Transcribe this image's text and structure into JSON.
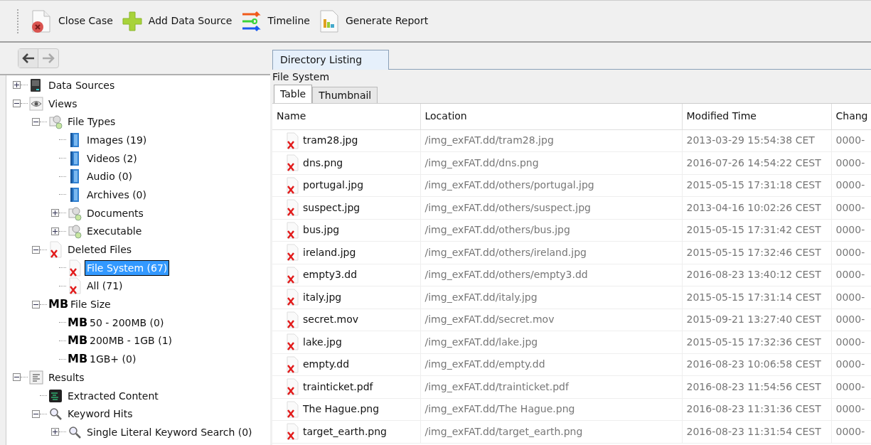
{
  "toolbar": [
    {
      "label": "Close Case"
    },
    {
      "label": "Add Data Source"
    },
    {
      "label": "Timeline"
    },
    {
      "label": "Generate Report"
    }
  ],
  "tree": [
    {
      "label": "Data Sources",
      "kind": "drive",
      "expanded": false,
      "selected": false
    },
    {
      "label": "Views",
      "kind": "eye",
      "expanded": true,
      "selected": false,
      "children": [
        {
          "label": "File Types",
          "kind": "filetype",
          "expanded": true,
          "selected": false,
          "children": [
            {
              "label": "Images (19)",
              "kind": "folder",
              "selected": false
            },
            {
              "label": "Videos (2)",
              "kind": "folder",
              "selected": false
            },
            {
              "label": "Audio (0)",
              "kind": "folder",
              "selected": false
            },
            {
              "label": "Archives (0)",
              "kind": "folder",
              "selected": false
            },
            {
              "label": "Documents",
              "kind": "filetype",
              "expanded": false,
              "selected": false
            },
            {
              "label": "Executable",
              "kind": "filetype",
              "expanded": false,
              "selected": false
            }
          ]
        },
        {
          "label": "Deleted Files",
          "kind": "deleted",
          "expanded": true,
          "selected": false,
          "children": [
            {
              "label": "File System (67)",
              "kind": "deleted",
              "selected": true
            },
            {
              "label": "All (71)",
              "kind": "deleted",
              "selected": false
            }
          ]
        },
        {
          "label": "File Size",
          "kind": "size",
          "icon_text": "MB",
          "expanded": true,
          "selected": false,
          "children": [
            {
              "label": "50 - 200MB (0)",
              "kind": "size",
              "icon_text": "MB",
              "selected": false
            },
            {
              "label": "200MB - 1GB (1)",
              "kind": "size",
              "icon_text": "MB",
              "selected": false
            },
            {
              "label": "1GB+ (0)",
              "kind": "size",
              "icon_text": "MB",
              "selected": false
            }
          ]
        }
      ]
    },
    {
      "label": "Results",
      "kind": "results",
      "expanded": true,
      "selected": false,
      "children": [
        {
          "label": "Extracted Content",
          "kind": "extracted",
          "selected": false
        },
        {
          "label": "Keyword Hits",
          "kind": "search",
          "expanded": true,
          "selected": false,
          "children": [
            {
              "label": "Single Literal Keyword Search (0)",
              "kind": "search",
              "expanded": false,
              "selected": false
            }
          ]
        }
      ]
    }
  ],
  "main_tabs": [
    {
      "label": "Directory Listing",
      "selected": true
    }
  ],
  "breadcrumb": "File System",
  "view_tabs": [
    {
      "label": "Table",
      "selected": true
    },
    {
      "label": "Thumbnail",
      "selected": false
    }
  ],
  "table": {
    "columns": [
      "Name",
      "Location",
      "Modified Time",
      "Chang"
    ],
    "rows": [
      [
        "tram28.jpg",
        "/img_exFAT.dd/tram28.jpg",
        "2013-03-29 15:54:38 CET",
        "0000-"
      ],
      [
        "dns.png",
        "/img_exFAT.dd/dns.png",
        "2016-07-26 14:54:22 CEST",
        "0000-"
      ],
      [
        "portugal.jpg",
        "/img_exFAT.dd/others/portugal.jpg",
        "2015-05-15 17:31:18 CEST",
        "0000-"
      ],
      [
        "suspect.jpg",
        "/img_exFAT.dd/others/suspect.jpg",
        "2013-04-16 10:02:26 CEST",
        "0000-"
      ],
      [
        "bus.jpg",
        "/img_exFAT.dd/others/bus.jpg",
        "2015-05-15 17:31:42 CEST",
        "0000-"
      ],
      [
        "ireland.jpg",
        "/img_exFAT.dd/others/ireland.jpg",
        "2015-05-15 17:32:46 CEST",
        "0000-"
      ],
      [
        "empty3.dd",
        "/img_exFAT.dd/others/empty3.dd",
        "2016-08-23 13:40:12 CEST",
        "0000-"
      ],
      [
        "italy.jpg",
        "/img_exFAT.dd/italy.jpg",
        "2015-05-15 17:31:14 CEST",
        "0000-"
      ],
      [
        "secret.mov",
        "/img_exFAT.dd/secret.mov",
        "2015-09-21 13:27:40 CEST",
        "0000-"
      ],
      [
        "lake.jpg",
        "/img_exFAT.dd/lake.jpg",
        "2015-05-15 17:32:36 CEST",
        "0000-"
      ],
      [
        "empty.dd",
        "/img_exFAT.dd/empty.dd",
        "2016-08-23 10:06:58 CEST",
        "0000-"
      ],
      [
        "trainticket.pdf",
        "/img_exFAT.dd/trainticket.pdf",
        "2016-08-23 11:54:56 CEST",
        "0000-"
      ],
      [
        "The Hague.png",
        "/img_exFAT.dd/The Hague.png",
        "2016-08-23 11:31:36 CEST",
        "0000-"
      ],
      [
        "target_earth.png",
        "/img_exFAT.dd/target_earth.png",
        "2016-08-23 11:31:54 CEST",
        "0000-"
      ]
    ]
  }
}
